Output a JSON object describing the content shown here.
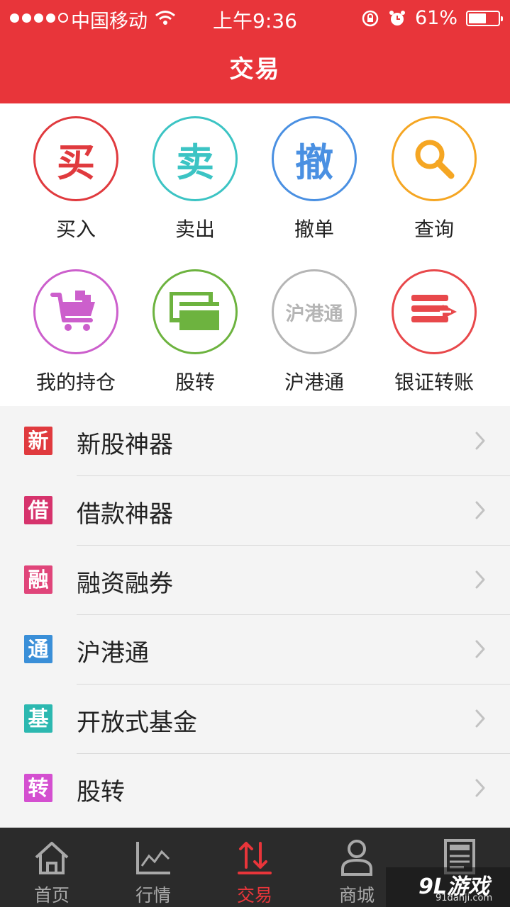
{
  "status": {
    "carrier": "中国移动",
    "time": "上午9:36",
    "battery_text": "61%",
    "battery_level": 0.61
  },
  "header": {
    "title": "交易"
  },
  "colors": {
    "brand": "#e8353a"
  },
  "grid": [
    {
      "label": "买入",
      "glyph": "买",
      "color": "#e03a3e",
      "icon": "buy-icon"
    },
    {
      "label": "卖出",
      "glyph": "卖",
      "color": "#3cc4c4",
      "icon": "sell-icon"
    },
    {
      "label": "撤单",
      "glyph": "撤",
      "color": "#4a90e2",
      "icon": "cancel-order-icon"
    },
    {
      "label": "查询",
      "glyph": "",
      "color": "#f5a623",
      "icon": "search-icon"
    },
    {
      "label": "我的持仓",
      "glyph": "",
      "color": "#cc5fcc",
      "icon": "cart-icon"
    },
    {
      "label": "股转",
      "glyph": "",
      "color": "#6db33f",
      "icon": "stock-transfer-icon"
    },
    {
      "label": "沪港通",
      "glyph": "沪港通",
      "color": "#b5b5b5",
      "icon": "hk-connect-icon"
    },
    {
      "label": "银证转账",
      "glyph": "",
      "color": "#e8484b",
      "icon": "bank-transfer-icon"
    }
  ],
  "list": [
    {
      "label": "新股神器",
      "badge": "新",
      "color": "#e03a3e"
    },
    {
      "label": "借款神器",
      "badge": "借",
      "color": "#d6336c"
    },
    {
      "label": "融资融券",
      "badge": "融",
      "color": "#e0457a"
    },
    {
      "label": "沪港通",
      "badge": "通",
      "color": "#3a8fd8"
    },
    {
      "label": "开放式基金",
      "badge": "基",
      "color": "#2cb8b0"
    },
    {
      "label": "股转",
      "badge": "转",
      "color": "#d44fd0"
    }
  ],
  "tabs": [
    {
      "label": "首页",
      "icon": "home-icon",
      "active": false
    },
    {
      "label": "行情",
      "icon": "market-chart-icon",
      "active": false
    },
    {
      "label": "交易",
      "icon": "trade-icon",
      "active": true
    },
    {
      "label": "商城",
      "icon": "store-user-icon",
      "active": false
    },
    {
      "label": "",
      "icon": "news-icon",
      "active": false
    }
  ],
  "watermark": {
    "main": "9L游戏",
    "sub": "91danji.com"
  }
}
